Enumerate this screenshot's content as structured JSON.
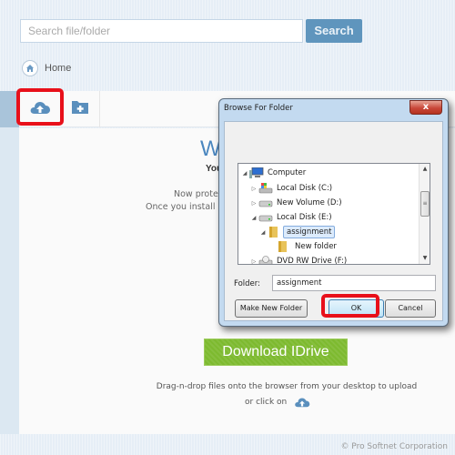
{
  "search": {
    "placeholder": "Search file/folder",
    "button_label": "Search"
  },
  "breadcrumb": {
    "home_label": "Home",
    "icon": "home-icon"
  },
  "toolbar": {
    "upload_icon": "cloud-upload-icon",
    "new_folder_icon": "folder-add-icon",
    "highlight_color": "#e8101a"
  },
  "content": {
    "welcome_title": "Welcome",
    "welcome_sub": "You",
    "desc_line1": "Now protect",
    "desc_line2": "Once you install and",
    "download_button": "Download IDrive",
    "dnd_text": "Drag-n-drop files onto the browser from your desktop to upload",
    "click_text": "or click on",
    "footer": "© Pro Softnet Corporation",
    "accent_color": "#4a86bf",
    "download_color": "#7dba2f"
  },
  "dialog": {
    "title": "Browse For Folder",
    "close_label": "x",
    "tree": [
      {
        "label": "Computer",
        "icon": "computer-icon",
        "expanded": true,
        "level": 0
      },
      {
        "label": "Local Disk (C:)",
        "icon": "system-drive-icon",
        "expanded": false,
        "level": 1
      },
      {
        "label": "New Volume (D:)",
        "icon": "drive-icon",
        "expanded": false,
        "level": 1
      },
      {
        "label": "Local Disk (E:)",
        "icon": "drive-icon",
        "expanded": true,
        "level": 1
      },
      {
        "label": "assignment",
        "icon": "folder-icon",
        "expanded": true,
        "level": 2,
        "selected": true
      },
      {
        "label": "New folder",
        "icon": "folder-icon",
        "level": 3
      },
      {
        "label": "DVD RW Drive (F:)",
        "icon": "dvd-drive-icon",
        "expanded": false,
        "level": 1
      }
    ],
    "folder_label": "Folder:",
    "folder_value": "assignment",
    "make_new_folder": "Make New Folder",
    "ok": "OK",
    "cancel": "Cancel"
  }
}
